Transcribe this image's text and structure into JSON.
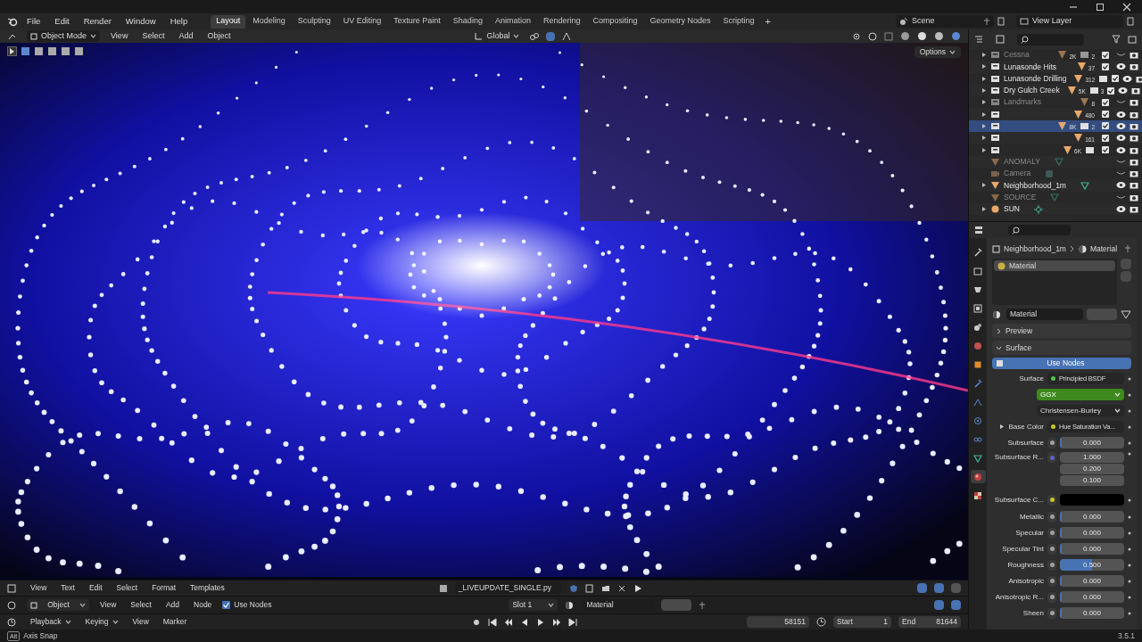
{
  "menu": [
    "File",
    "Edit",
    "Render",
    "Window",
    "Help"
  ],
  "workspaces": [
    {
      "label": "Layout",
      "selected": true
    },
    {
      "label": "Modeling",
      "selected": false
    },
    {
      "label": "Sculpting",
      "selected": false
    },
    {
      "label": "UV Editing",
      "selected": false
    },
    {
      "label": "Texture Paint",
      "selected": false
    },
    {
      "label": "Shading",
      "selected": false
    },
    {
      "label": "Animation",
      "selected": false
    },
    {
      "label": "Rendering",
      "selected": false
    },
    {
      "label": "Compositing",
      "selected": false
    },
    {
      "label": "Geometry Nodes",
      "selected": false
    },
    {
      "label": "Scripting",
      "selected": false
    }
  ],
  "add_workspace": "+",
  "scene": "Scene",
  "view_layer": "View Layer",
  "viewport_header": {
    "mode": "Object Mode",
    "menus": [
      "View",
      "Select",
      "Add",
      "Object"
    ],
    "orientation": "Global"
  },
  "viewport": {
    "options": "Options"
  },
  "outliner": {
    "rows": [
      {
        "name": "Cessna",
        "kind": "collection",
        "expandable": true,
        "dimmed": true,
        "selected": false,
        "checked": true,
        "visible": false,
        "counts": [
          {
            "kind": "mesh",
            "text": "2K"
          },
          {
            "kind": "collection",
            "text": "2"
          }
        ]
      },
      {
        "name": "Lunasonde Hits",
        "kind": "collection",
        "expandable": true,
        "dimmed": false,
        "selected": false,
        "checked": true,
        "visible": true,
        "counts": [
          {
            "kind": "mesh",
            "text": "37"
          }
        ]
      },
      {
        "name": "Lunasonde Drilling",
        "kind": "collection",
        "expandable": true,
        "dimmed": false,
        "selected": false,
        "checked": true,
        "visible": true,
        "counts": [
          {
            "kind": "mesh",
            "text": "312"
          },
          {
            "kind": "collection"
          }
        ]
      },
      {
        "name": "Dry Gulch Creek",
        "kind": "collection",
        "expandable": true,
        "dimmed": false,
        "selected": false,
        "checked": true,
        "visible": true,
        "counts": [
          {
            "kind": "mesh",
            "text": "5K"
          },
          {
            "kind": "collection",
            "text": "3"
          }
        ]
      },
      {
        "name": "Landmarks",
        "kind": "collection",
        "expandable": true,
        "dimmed": true,
        "selected": false,
        "checked": true,
        "visible": false,
        "counts": [
          {
            "kind": "mesh",
            "text": "8"
          }
        ]
      },
      {
        "kind": "collection",
        "expandable": true,
        "dimmed": false,
        "selected": false,
        "checked": true,
        "visible": true,
        "counts": [
          {
            "kind": "mesh",
            "text": "480"
          }
        ]
      },
      {
        "kind": "collection",
        "expandable": true,
        "dimmed": false,
        "selected": true,
        "checked": true,
        "visible": true,
        "counts": [
          {
            "kind": "mesh",
            "text": "8K"
          },
          {
            "kind": "collection",
            "text": "2"
          }
        ]
      },
      {
        "kind": "collection",
        "expandable": true,
        "dimmed": false,
        "selected": false,
        "checked": true,
        "visible": true,
        "counts": [
          {
            "kind": "mesh",
            "text": "161"
          }
        ]
      },
      {
        "kind": "collection",
        "expandable": true,
        "dimmed": false,
        "selected": false,
        "checked": true,
        "visible": true,
        "counts": [
          {
            "kind": "mesh",
            "text": "6K"
          },
          {
            "kind": "collection"
          }
        ]
      },
      {
        "name": "ANOMALY",
        "kind": "mesh",
        "expandable": false,
        "dimmed": true,
        "selected": false,
        "visible": false
      },
      {
        "name": "Camera",
        "kind": "camera",
        "expandable": false,
        "dimmed": true,
        "selected": false,
        "visible": false
      },
      {
        "name": "Neighborhood_1m",
        "kind": "mesh",
        "expandable": true,
        "dimmed": false,
        "selected": false,
        "visible": true
      },
      {
        "name": "SOURCE",
        "kind": "mesh",
        "expandable": false,
        "dimmed": true,
        "selected": false,
        "visible": false
      },
      {
        "name": "SUN",
        "kind": "light",
        "expandable": true,
        "dimmed": false,
        "selected": false,
        "visible": true
      }
    ]
  },
  "properties": {
    "tabs": [
      {
        "kind": "tool",
        "selected": false
      },
      {
        "kind": "render",
        "selected": false
      },
      {
        "kind": "output",
        "selected": false
      },
      {
        "kind": "view_layer",
        "selected": false
      },
      {
        "kind": "scene",
        "selected": false
      },
      {
        "kind": "world",
        "selected": false
      },
      {
        "kind": "object",
        "selected": false
      },
      {
        "kind": "modifier",
        "selected": false
      },
      {
        "kind": "particles",
        "selected": false
      },
      {
        "kind": "physics",
        "selected": false
      },
      {
        "kind": "constraints",
        "selected": false
      },
      {
        "kind": "data",
        "selected": false
      },
      {
        "kind": "material",
        "selected": true
      },
      {
        "kind": "texture",
        "selected": false
      }
    ],
    "breadcrumb": [
      "Neighborhood_1m",
      "Material"
    ],
    "slots": [
      {
        "name": "Material",
        "selected": true
      }
    ],
    "material": "Material",
    "panels": [
      {
        "title": "Preview",
        "expanded": false
      },
      {
        "title": "Surface",
        "expanded": true
      }
    ],
    "use_nodes": "Use Nodes",
    "fields": [
      {
        "kind": "link",
        "label": "Surface",
        "color": "#4fc24f",
        "value": "Principled BSDF"
      },
      {
        "kind": "dropdown",
        "value": "GGX",
        "highlight": true
      },
      {
        "kind": "dropdown",
        "value": "Christensen-Burley",
        "highlight": false
      },
      {
        "kind": "link",
        "label": "Base Color",
        "color": "#c7c729",
        "value": "Hue Saturation Va...",
        "expandable": true
      },
      {
        "kind": "value",
        "label": "Subsurface",
        "color": "#a1a1a1",
        "value": "0.000",
        "level": 0
      },
      {
        "kind": "vector",
        "label": "Subsurface R...",
        "color": "#6363c7",
        "values": [
          "1.000",
          "0.200",
          "0.100"
        ]
      },
      {
        "kind": "color",
        "label": "Subsurface C...",
        "color": "#c7c729"
      },
      {
        "kind": "value",
        "label": "Metallic",
        "color": "#a1a1a1",
        "value": "0.000",
        "level": 0
      },
      {
        "kind": "value",
        "label": "Specular",
        "color": "#a1a1a1",
        "value": "0.000",
        "level": 0
      },
      {
        "kind": "value",
        "label": "Specular Tint",
        "color": "#a1a1a1",
        "value": "0.000",
        "level": 0
      },
      {
        "kind": "value",
        "label": "Roughness",
        "color": "#a1a1a1",
        "value": "0.500",
        "level": 0.5
      },
      {
        "kind": "value",
        "label": "Anisotropic",
        "color": "#a1a1a1",
        "value": "0.000",
        "level": 0
      },
      {
        "kind": "value",
        "label": "Anisotropic R...",
        "color": "#a1a1a1",
        "value": "0.000",
        "level": 0
      },
      {
        "kind": "value",
        "label": "Sheen",
        "color": "#a1a1a1",
        "value": "0.000",
        "level": 0
      }
    ]
  },
  "text_editor_header": {
    "menus": [
      "View",
      "Text",
      "Edit",
      "Select",
      "Format",
      "Templates"
    ],
    "file": "_LIVEUPDATE_SINGLE.py"
  },
  "shader_header": {
    "object": "Object",
    "menus": [
      "View",
      "Select",
      "Add",
      "Node"
    ],
    "use_nodes": {
      "label": "Use Nodes",
      "checked": true
    },
    "slot": "Slot 1",
    "material": "Material"
  },
  "timeline": {
    "menus": [
      "Playback",
      "Keying",
      "View",
      "Marker"
    ],
    "frame": "58151",
    "start_label": "Start",
    "start": "1",
    "end_label": "End",
    "end": "81644"
  },
  "status_bar": {
    "key": "Alt",
    "hint": "Axis Snap",
    "version": "3.5.1"
  }
}
